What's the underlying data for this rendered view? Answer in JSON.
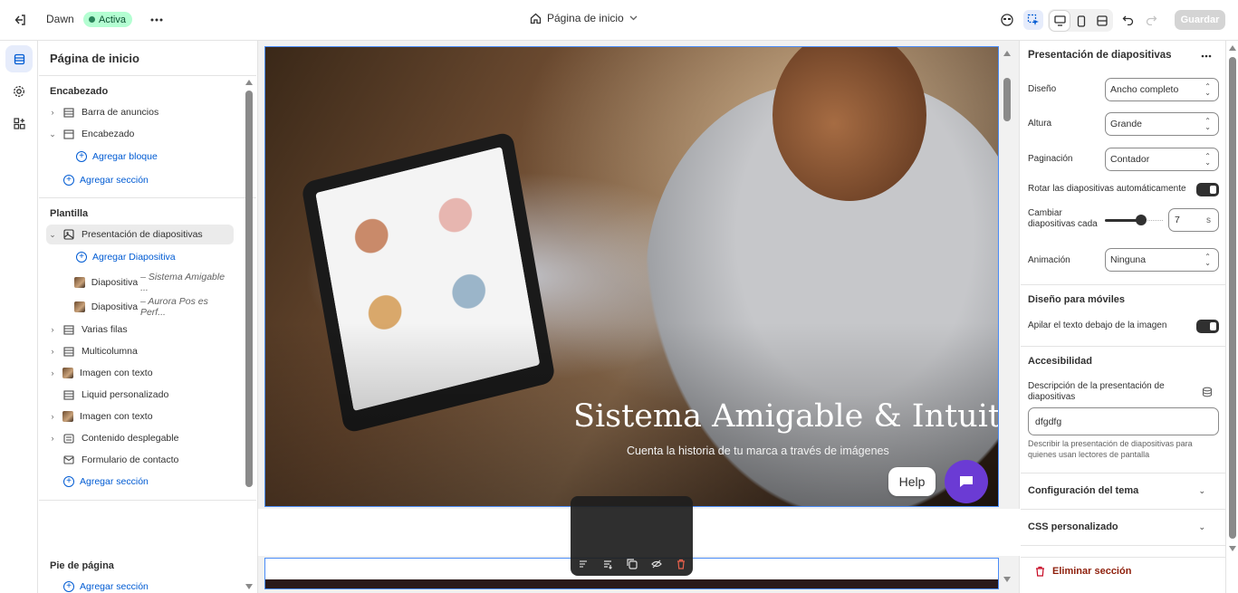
{
  "topbar": {
    "theme_name": "Dawn",
    "status_badge": "Activa",
    "page_selector": "Página de inicio",
    "save_label": "Guardar"
  },
  "sidebar": {
    "title": "Página de inicio",
    "header_group": "Encabezado",
    "header_items": [
      {
        "label": "Barra de anuncios"
      },
      {
        "label": "Encabezado"
      }
    ],
    "add_block": "Agregar bloque",
    "add_section": "Agregar sección",
    "template_group": "Plantilla",
    "slideshow": "Presentación de diapositivas",
    "add_slide": "Agregar Diapositiva",
    "slides": [
      {
        "label": "Diapositiva",
        "detail": "– Sistema Amigable ..."
      },
      {
        "label": "Diapositiva",
        "detail": "– Aurora Pos es Perf..."
      }
    ],
    "template_items": [
      {
        "label": "Varias filas"
      },
      {
        "label": "Multicolumna"
      },
      {
        "label": "Imagen con texto"
      },
      {
        "label": "Liquid personalizado"
      },
      {
        "label": "Imagen con texto"
      },
      {
        "label": "Contenido desplegable"
      },
      {
        "label": "Formulario de contacto"
      }
    ],
    "footer_group": "Pie de página"
  },
  "preview": {
    "slide_heading": "Sistema Amigable & Intuitivo",
    "slide_subheading": "Cuenta la historia de tu marca a través de imágenes",
    "help_label": "Help"
  },
  "settings": {
    "title": "Presentación de diapositivas",
    "layout_label": "Diseño",
    "layout_value": "Ancho completo",
    "height_label": "Altura",
    "height_value": "Grande",
    "pagination_label": "Paginación",
    "pagination_value": "Contador",
    "autorotate_label": "Rotar las diapositivas automáticamente",
    "autorotate_on": true,
    "change_every_label": "Cambiar diapositivas cada",
    "change_every_value": "7",
    "change_every_unit": "s",
    "animation_label": "Animación",
    "animation_value": "Ninguna",
    "mobile_heading": "Diseño para móviles",
    "stack_label": "Apilar el texto debajo de la imagen",
    "stack_on": true,
    "accessibility_heading": "Accesibilidad",
    "description_label": "Descripción de la presentación de diapositivas",
    "description_value": "dfgdfg",
    "description_help": "Describir la presentación de diapositivas para quienes usan lectores de pantalla",
    "theme_settings": "Configuración del tema",
    "custom_css": "CSS personalizado",
    "delete_section": "Eliminar sección"
  },
  "colors": {
    "accent_blue": "#005bd3",
    "badge_green": "#b4fed2",
    "delete_red": "#8e1f0b",
    "chat_purple": "#6b3bd4"
  }
}
